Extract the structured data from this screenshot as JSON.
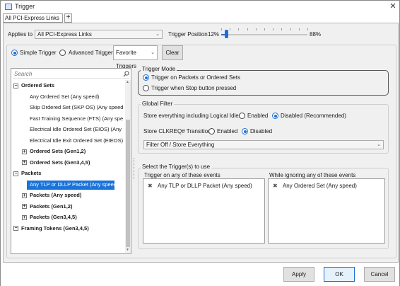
{
  "window": {
    "title": "Trigger",
    "close_glyph": "✕"
  },
  "tabs": [
    {
      "label": "All PCI-Express Links"
    }
  ],
  "tab_add_glyph": "+",
  "applies_to": {
    "label": "Applies to",
    "value": "All PCI-Express Links"
  },
  "trigger_position": {
    "label": "Trigger Position",
    "min_label": "12%",
    "max_label": "88%",
    "value_fraction": 0.06
  },
  "mode_tabs": {
    "simple_label": "Simple Trigger",
    "simple_selected": true,
    "advanced_label": "Advanced Trigger",
    "advanced_selected": false,
    "favorites_label": "Favorite Triggers",
    "clear_label": "Clear"
  },
  "search": {
    "placeholder": "Search"
  },
  "tree": [
    {
      "label": "Ordered Sets",
      "bold": true,
      "level": 0,
      "expander": "−"
    },
    {
      "label": "Any Ordered Set (Any speed)",
      "bold": false,
      "level": 1
    },
    {
      "label": "Skip Ordered Set (SKP OS) (Any speed)",
      "bold": false,
      "level": 1
    },
    {
      "label": "Fast Training Sequence (FTS) (Any speed)",
      "bold": false,
      "level": 1
    },
    {
      "label": "Electrical Idle Ordered Set (EIOS) (Any sp",
      "bold": false,
      "level": 1
    },
    {
      "label": "Electrical Idle Exit Ordered Set (EIEOS) (A",
      "bold": false,
      "level": 1
    },
    {
      "label": "Ordered Sets (Gen1,2)",
      "bold": true,
      "level": 1,
      "expander": "+"
    },
    {
      "label": "Ordered Sets (Gen3,4,5)",
      "bold": true,
      "level": 1,
      "expander": "+"
    },
    {
      "label": "Packets",
      "bold": true,
      "level": 0,
      "expander": "−"
    },
    {
      "label": "Any TLP or DLLP Packet (Any speed)",
      "bold": false,
      "level": 1,
      "selected": true
    },
    {
      "label": "Packets (Any speed)",
      "bold": true,
      "level": 1,
      "expander": "+"
    },
    {
      "label": "Packets (Gen1,2)",
      "bold": true,
      "level": 1,
      "expander": "+"
    },
    {
      "label": "Packets (Gen3,4,5)",
      "bold": true,
      "level": 1,
      "expander": "+"
    },
    {
      "label": "Framing Tokens (Gen3,4,5)",
      "bold": true,
      "level": 0,
      "expander": "−"
    }
  ],
  "trigger_mode": {
    "title": "Trigger Mode",
    "option1": "Trigger on Packets or Ordered Sets",
    "option1_selected": true,
    "option2": "Trigger when Stop button pressed",
    "option2_selected": false
  },
  "global_filter": {
    "title": "Global Filter",
    "logical_idles_label": "Store everything including Logical Idles",
    "enabled_label": "Enabled",
    "disabled_rec_label": "Disabled (Recommended)",
    "clkreq_label": "Store CLKREQ# Transitions",
    "clkreq_enabled_label": "Enabled",
    "clkreq_disabled_label": "Disabled",
    "filter_value": "Filter Off / Store Everything"
  },
  "triggers": {
    "title": "Select the Trigger(s) to use",
    "left_header": "Trigger on any of these events",
    "left_items": [
      "Any TLP or DLLP Packet (Any speed)"
    ],
    "right_header": "While ignoring any of these events",
    "right_items": [
      "Any Ordered Set (Any speed)"
    ]
  },
  "footer": {
    "apply": "Apply",
    "ok": "OK",
    "cancel": "Cancel"
  }
}
